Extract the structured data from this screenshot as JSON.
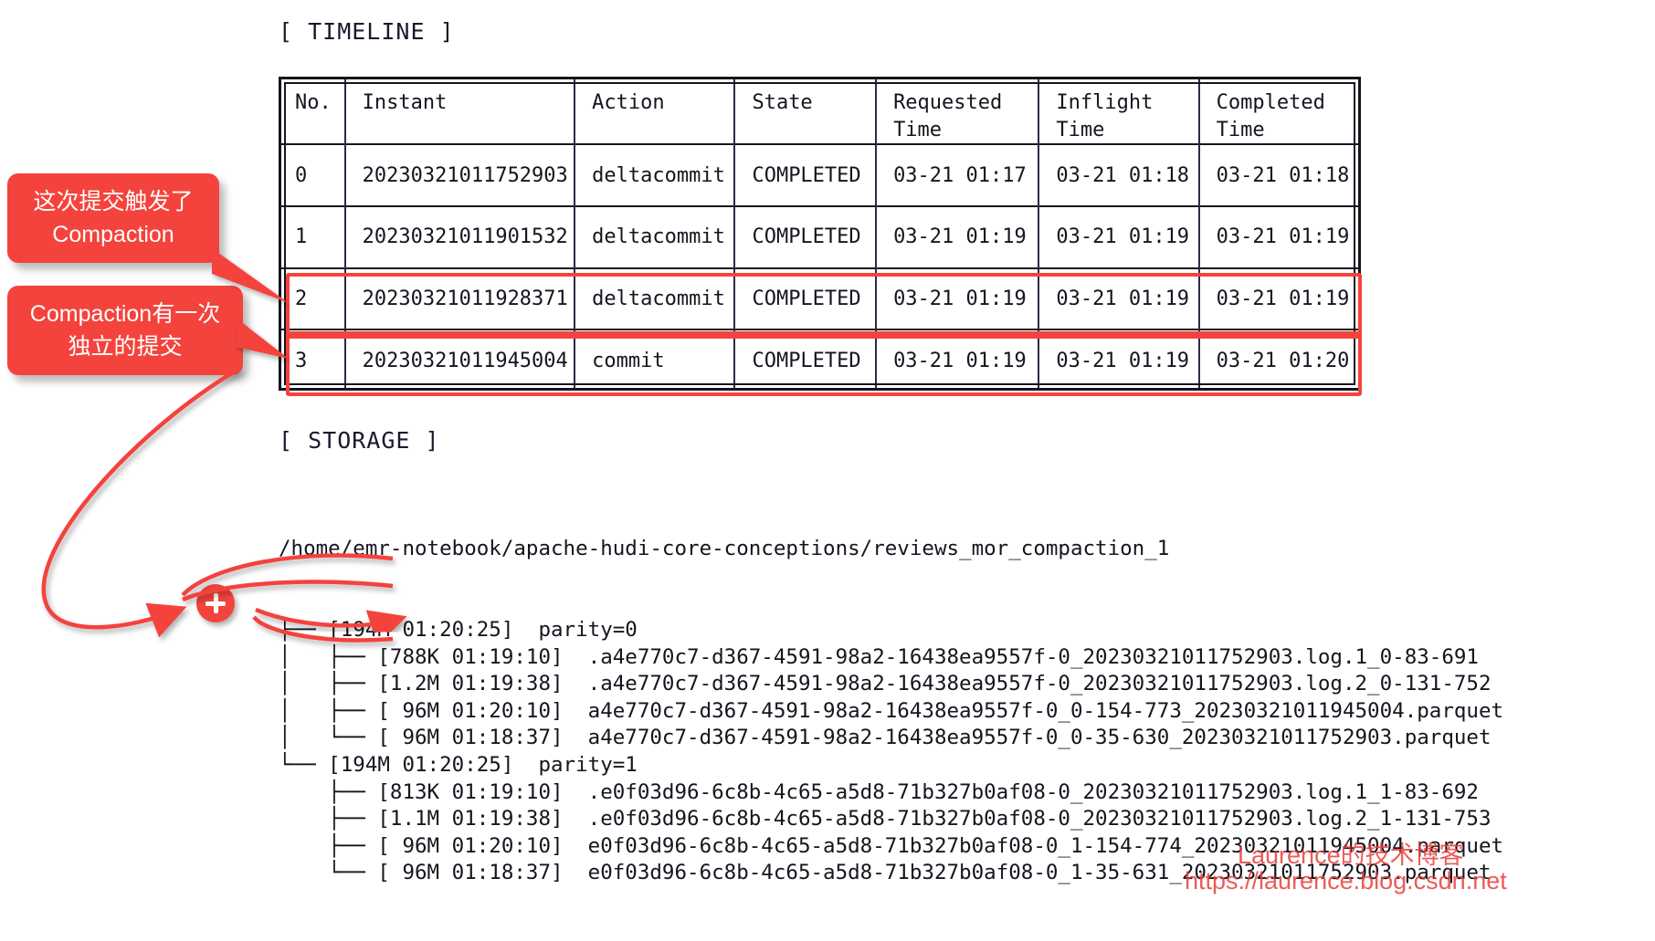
{
  "sections": {
    "timeline_label": "[ TIMELINE ]",
    "storage_label": "[ STORAGE ]"
  },
  "timeline": {
    "columns": [
      "No.",
      "Instant",
      "Action",
      "State",
      "Requested\nTime",
      "Inflight\nTime",
      "Completed\nTime"
    ],
    "rows": [
      {
        "no": "0",
        "instant": "20230321011752903",
        "action": "deltacommit",
        "state": "COMPLETED",
        "requested": "03-21 01:17",
        "inflight": "03-21 01:18",
        "completed": "03-21 01:18",
        "highlighted": false
      },
      {
        "no": "1",
        "instant": "20230321011901532",
        "action": "deltacommit",
        "state": "COMPLETED",
        "requested": "03-21 01:19",
        "inflight": "03-21 01:19",
        "completed": "03-21 01:19",
        "highlighted": false
      },
      {
        "no": "2",
        "instant": "20230321011928371",
        "action": "deltacommit",
        "state": "COMPLETED",
        "requested": "03-21 01:19",
        "inflight": "03-21 01:19",
        "completed": "03-21 01:19",
        "highlighted": true
      },
      {
        "no": "3",
        "instant": "20230321011945004",
        "action": "commit",
        "state": "COMPLETED",
        "requested": "03-21 01:19",
        "inflight": "03-21 01:19",
        "completed": "03-21 01:20",
        "highlighted": true
      }
    ]
  },
  "callouts": [
    {
      "line1": "这次提交触发了",
      "line2": "Compaction"
    },
    {
      "line1": "Compaction有一次",
      "line2": "独立的提交"
    }
  ],
  "storage": {
    "root_path": "/home/emr-notebook/apache-hudi-core-conceptions/reviews_mor_compaction_1",
    "lines": [
      "├── [194M 01:20:25]  parity=0",
      "│   ├── [788K 01:19:10]  .a4e770c7-d367-4591-98a2-16438ea9557f-0_20230321011752903.log.1_0-83-691",
      "│   ├── [1.2M 01:19:38]  .a4e770c7-d367-4591-98a2-16438ea9557f-0_20230321011752903.log.2_0-131-752",
      "│   ├── [ 96M 01:20:10]  a4e770c7-d367-4591-98a2-16438ea9557f-0_0-154-773_20230321011945004.parquet",
      "│   └── [ 96M 01:18:37]  a4e770c7-d367-4591-98a2-16438ea9557f-0_0-35-630_20230321011752903.parquet",
      "└── [194M 01:20:25]  parity=1",
      "    ├── [813K 01:19:10]  .e0f03d96-6c8b-4c65-a5d8-71b327b0af08-0_20230321011752903.log.1_1-83-692",
      "    ├── [1.1M 01:19:38]  .e0f03d96-6c8b-4c65-a5d8-71b327b0af08-0_20230321011752903.log.2_1-131-753",
      "    ├── [ 96M 01:20:10]  e0f03d96-6c8b-4c65-a5d8-71b327b0af08-0_1-154-774_20230321011945004.parquet",
      "    └── [ 96M 01:18:37]  e0f03d96-6c8b-4c65-a5d8-71b327b0af08-0_1-35-631_20230321011752903.parquet"
    ]
  },
  "badges": {
    "merge_plus": "+"
  },
  "watermark": {
    "line1": "Laurence的技术博客",
    "line2": "https://laurence.blog.csdn.net"
  },
  "colors": {
    "accent_red": "#f4433c",
    "text": "#15151f",
    "background": "#ffffff"
  }
}
